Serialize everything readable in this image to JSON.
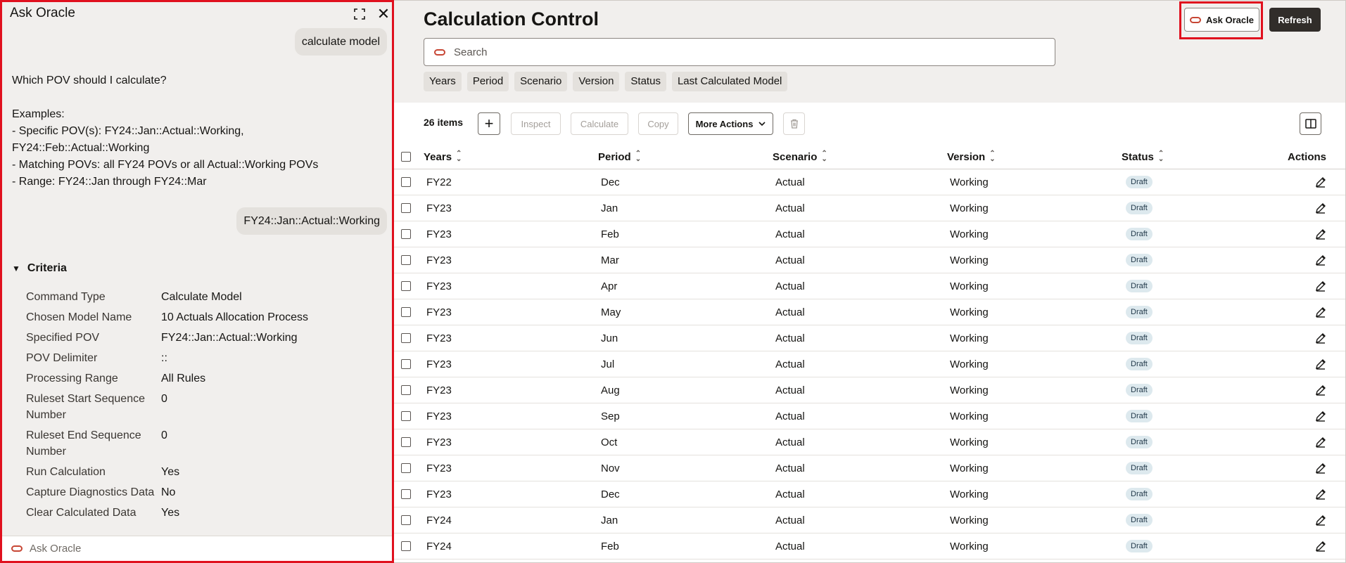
{
  "ask_panel": {
    "title": "Ask Oracle",
    "user_msg_1": "calculate model",
    "assistant_lines": [
      "Which POV should I calculate?",
      "",
      "Examples:",
      "- Specific POV(s): FY24::Jan::Actual::Working,",
      "FY24::Feb::Actual::Working",
      "- Matching POVs: all FY24 POVs or all Actual::Working POVs",
      "- Range: FY24::Jan through FY24::Mar"
    ],
    "user_msg_2": "FY24::Jan::Actual::Working",
    "criteria_label": "Criteria",
    "criteria": [
      {
        "key": "Command Type",
        "value": "Calculate Model"
      },
      {
        "key": "Chosen Model Name",
        "value": "10 Actuals Allocation Process"
      },
      {
        "key": "Specified POV",
        "value": "FY24::Jan::Actual::Working"
      },
      {
        "key": "POV Delimiter",
        "value": "::"
      },
      {
        "key": "Processing Range",
        "value": "All Rules"
      },
      {
        "key": "Ruleset Start Sequence Number",
        "value": "0"
      },
      {
        "key": "Ruleset End Sequence Number",
        "value": "0"
      },
      {
        "key": "Run Calculation",
        "value": "Yes"
      },
      {
        "key": "Capture Diagnostics Data",
        "value": "No"
      },
      {
        "key": "Clear Calculated Data",
        "value": "Yes"
      }
    ],
    "input_placeholder": "Ask Oracle"
  },
  "header": {
    "title": "Calculation Control",
    "ask_oracle_label": "Ask Oracle",
    "refresh_label": "Refresh",
    "search_placeholder": "Search",
    "filters": [
      "Years",
      "Period",
      "Scenario",
      "Version",
      "Status",
      "Last Calculated Model"
    ]
  },
  "toolbar": {
    "count": "26 items",
    "inspect": "Inspect",
    "calculate": "Calculate",
    "copy": "Copy",
    "more_actions": "More Actions"
  },
  "table": {
    "columns": {
      "years": "Years",
      "period": "Period",
      "scenario": "Scenario",
      "version": "Version",
      "status": "Status",
      "actions": "Actions"
    },
    "rows": [
      {
        "years": "FY22",
        "period": "Dec",
        "scenario": "Actual",
        "version": "Working",
        "status": "Draft"
      },
      {
        "years": "FY23",
        "period": "Jan",
        "scenario": "Actual",
        "version": "Working",
        "status": "Draft"
      },
      {
        "years": "FY23",
        "period": "Feb",
        "scenario": "Actual",
        "version": "Working",
        "status": "Draft"
      },
      {
        "years": "FY23",
        "period": "Mar",
        "scenario": "Actual",
        "version": "Working",
        "status": "Draft"
      },
      {
        "years": "FY23",
        "period": "Apr",
        "scenario": "Actual",
        "version": "Working",
        "status": "Draft"
      },
      {
        "years": "FY23",
        "period": "May",
        "scenario": "Actual",
        "version": "Working",
        "status": "Draft"
      },
      {
        "years": "FY23",
        "period": "Jun",
        "scenario": "Actual",
        "version": "Working",
        "status": "Draft"
      },
      {
        "years": "FY23",
        "period": "Jul",
        "scenario": "Actual",
        "version": "Working",
        "status": "Draft"
      },
      {
        "years": "FY23",
        "period": "Aug",
        "scenario": "Actual",
        "version": "Working",
        "status": "Draft"
      },
      {
        "years": "FY23",
        "period": "Sep",
        "scenario": "Actual",
        "version": "Working",
        "status": "Draft"
      },
      {
        "years": "FY23",
        "period": "Oct",
        "scenario": "Actual",
        "version": "Working",
        "status": "Draft"
      },
      {
        "years": "FY23",
        "period": "Nov",
        "scenario": "Actual",
        "version": "Working",
        "status": "Draft"
      },
      {
        "years": "FY23",
        "period": "Dec",
        "scenario": "Actual",
        "version": "Working",
        "status": "Draft"
      },
      {
        "years": "FY24",
        "period": "Jan",
        "scenario": "Actual",
        "version": "Working",
        "status": "Draft"
      },
      {
        "years": "FY24",
        "period": "Feb",
        "scenario": "Actual",
        "version": "Working",
        "status": "Draft"
      }
    ]
  },
  "icons": {
    "expand": "expand-icon",
    "close": "close-icon",
    "add": "plus-icon",
    "delete": "trash-icon",
    "panel_toggle": "split-panel-icon",
    "edit": "pencil-icon",
    "oracle": "oracle-logo-icon",
    "sort": "sort-icon",
    "chevron": "chevron-down-icon"
  },
  "colors": {
    "highlight": "#e0101e",
    "oracle_red": "#c74634",
    "primary_button": "#312d2a",
    "status_badge": "#dde9ee"
  }
}
